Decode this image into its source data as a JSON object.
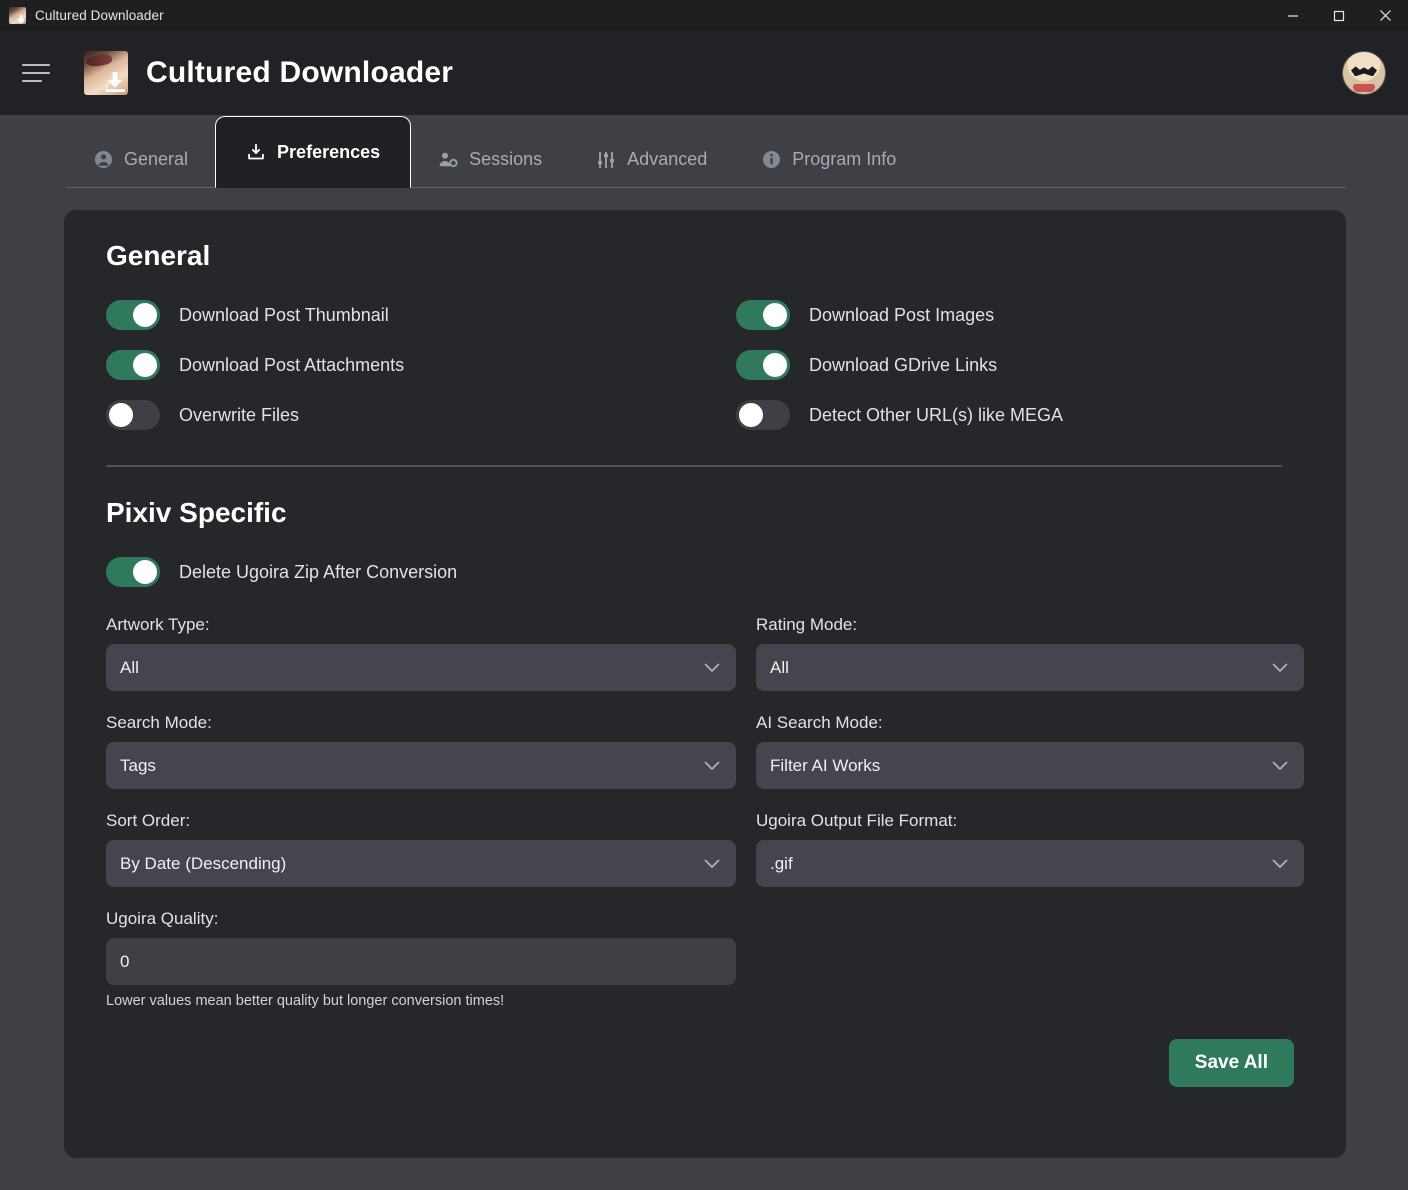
{
  "titlebar": {
    "title": "Cultured Downloader",
    "app_icon": "app-logo-icon",
    "minimize": "minimize-icon",
    "maximize": "maximize-icon",
    "close": "close-icon"
  },
  "header": {
    "menu_icon": "hamburger-icon",
    "logo_icon": "app-logo-icon",
    "title": "Cultured Downloader",
    "avatar_icon": "user-avatar"
  },
  "tabs": [
    {
      "label": "General",
      "icon": "user-circle-icon",
      "active": false
    },
    {
      "label": "Preferences",
      "icon": "download-tray-icon",
      "active": true
    },
    {
      "label": "Sessions",
      "icon": "user-gear-icon",
      "active": false
    },
    {
      "label": "Advanced",
      "icon": "sliders-icon",
      "active": false
    },
    {
      "label": "Program Info",
      "icon": "info-circle-icon",
      "active": false
    }
  ],
  "general": {
    "heading": "General",
    "toggles": [
      {
        "label": "Download Post Thumbnail",
        "on": true
      },
      {
        "label": "Download Post Images",
        "on": true
      },
      {
        "label": "Download Post Attachments",
        "on": true
      },
      {
        "label": "Download GDrive Links",
        "on": true
      },
      {
        "label": "Overwrite Files",
        "on": false
      },
      {
        "label": "Detect Other URL(s) like MEGA",
        "on": false
      }
    ]
  },
  "pixiv": {
    "heading": "Pixiv Specific",
    "toggle": {
      "label": "Delete Ugoira Zip After Conversion",
      "on": true
    },
    "fields": [
      {
        "label": "Artwork Type:",
        "value": "All",
        "type": "select"
      },
      {
        "label": "Rating Mode:",
        "value": "All",
        "type": "select"
      },
      {
        "label": "Search Mode:",
        "value": "Tags",
        "type": "select"
      },
      {
        "label": "AI Search Mode:",
        "value": "Filter AI Works",
        "type": "select"
      },
      {
        "label": "Sort Order:",
        "value": "By Date (Descending)",
        "type": "select"
      },
      {
        "label": "Ugoira Output File Format:",
        "value": ".gif",
        "type": "select"
      },
      {
        "label": "Ugoira Quality:",
        "value": "0",
        "type": "input"
      }
    ],
    "help_text": "Lower values mean better quality but longer conversion times!"
  },
  "footer": {
    "save_label": "Save All"
  },
  "colors": {
    "accent_green": "#2f7a5c",
    "page_bg": "#3e4046",
    "card_bg": "#26272b",
    "control_bg": "#45464d",
    "text": "#dfe2e8"
  }
}
